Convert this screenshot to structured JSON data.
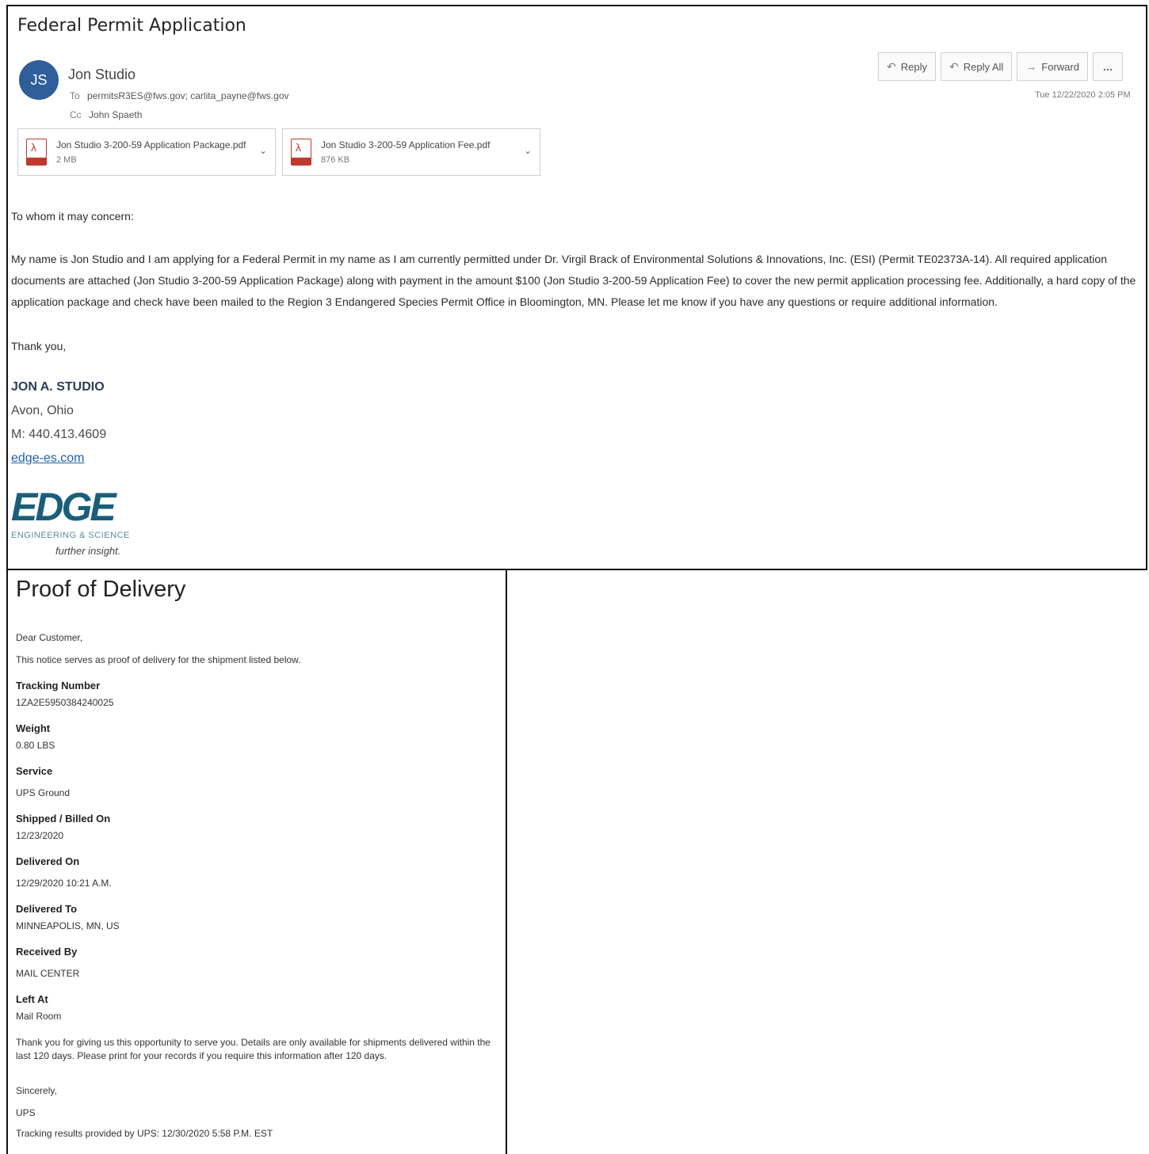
{
  "email": {
    "subject": "Federal Permit Application",
    "avatar_initials": "JS",
    "avatar_color": "#2f5f9a",
    "sender": "Jon Studio",
    "to_label": "To",
    "to": "permitsR3ES@fws.gov; carlita_payne@fws.gov",
    "cc_label": "Cc",
    "cc": "John Spaeth",
    "actions": {
      "reply": "Reply",
      "reply_all": "Reply All",
      "forward": "Forward",
      "more": "…"
    },
    "timestamp": "Tue 12/22/2020 2:05 PM",
    "attachments": [
      {
        "name": "Jon Studio 3-200-59 Application Package.pdf",
        "size": "2 MB"
      },
      {
        "name": "Jon Studio 3-200-59 Application Fee.pdf",
        "size": "876 KB"
      }
    ],
    "greeting": "To whom it may concern:",
    "body": "My name is Jon Studio and I am applying for a Federal Permit in my name as I am currently permitted under Dr. Virgil Brack of Environmental Solutions & Innovations, Inc. (ESI) (Permit TE02373A-14). All required application documents are attached (Jon Studio 3-200-59 Application Package) along with payment in the amount $100 (Jon Studio 3-200-59 Application Fee) to cover the new permit application processing fee. Additionally, a hard copy of the application package and check have been mailed to the Region 3 Endangered Species Permit Office in Bloomington, MN. Please let me know if you have any questions or require additional information.",
    "closing": "Thank you,",
    "signature": {
      "name": "JON A. STUDIO",
      "location": "Avon, Ohio",
      "phone": "M: 440.413.4609",
      "website": "edge-es.com",
      "logo_text": "EDGE",
      "logo_subtitle": "ENGINEERING & SCIENCE",
      "logo_tagline": "further insight."
    }
  },
  "pod": {
    "title": "Proof of Delivery",
    "salutation": "Dear Customer,",
    "intro": "This notice serves as proof of delivery for the shipment listed below.",
    "fields": [
      {
        "label": "Tracking Number",
        "value": "1ZA2E5950384240025"
      },
      {
        "label": "Weight",
        "value": "0.80 LBS"
      },
      {
        "label": "Service",
        "value": "UPS Ground"
      },
      {
        "label": "Shipped / Billed On",
        "value": "12/23/2020"
      },
      {
        "label": "Delivered On",
        "value": "12/29/2020 10:21 A.M."
      },
      {
        "label": "Delivered To",
        "value": "MINNEAPOLIS, MN, US"
      },
      {
        "label": "Received By",
        "value": "MAIL CENTER"
      },
      {
        "label": "Left At",
        "value": "Mail Room"
      }
    ],
    "closing_note": "Thank you for giving us this opportunity to serve you. Details are only available for shipments delivered within the last 120 days. Please print for your records if you require this information after 120 days.",
    "sign_off": "Sincerely,",
    "company": "UPS",
    "footer": "Tracking results provided by UPS: 12/30/2020 5:58 P.M. EST"
  }
}
